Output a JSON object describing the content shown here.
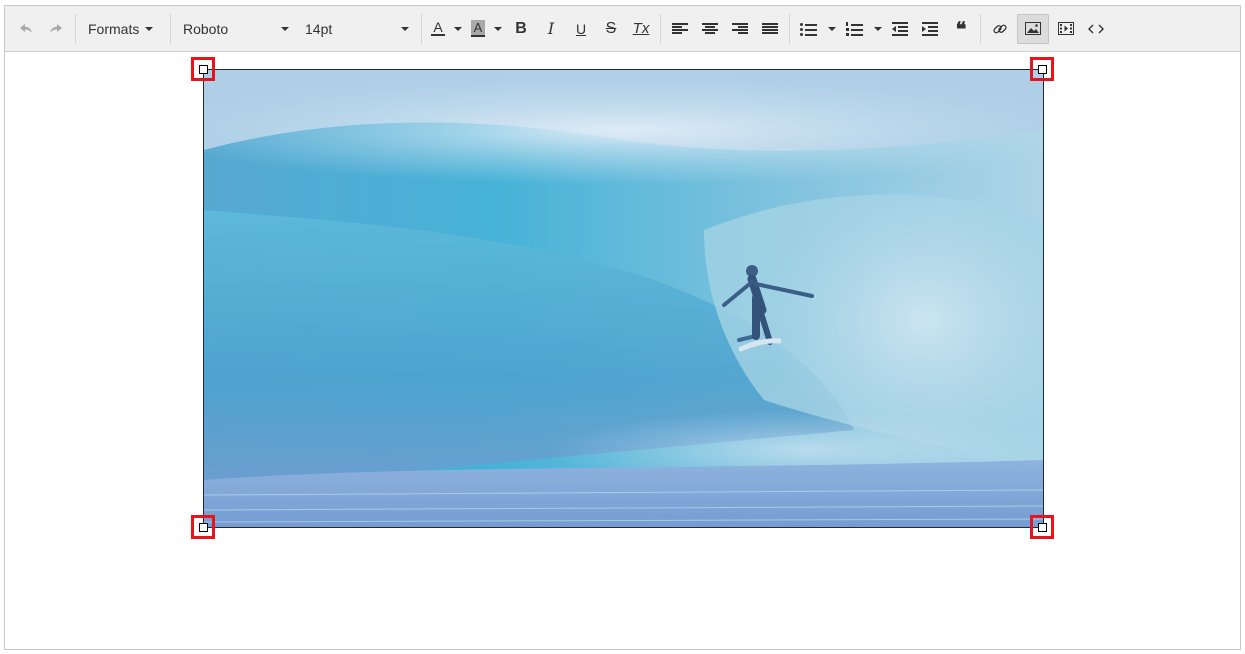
{
  "toolbar": {
    "undo_icon": "undo-icon",
    "redo_icon": "redo-icon",
    "formats_label": "Formats",
    "font_family": "Roboto",
    "font_size": "14pt",
    "text_color_glyph": "A",
    "bg_color_glyph": "A",
    "bold_glyph": "B",
    "italic_glyph": "I",
    "underline_glyph": "U",
    "strike_glyph": "S",
    "clear_format_glyph": "Tx",
    "blockquote_glyph": "❝"
  },
  "colors": {
    "toolbar_bg": "#f0f0f0",
    "handle_red": "#e8141c",
    "wave_light": "#8fd4e6",
    "wave_deep": "#2a9fc4"
  },
  "content": {
    "image_subject": "surfer-riding-wave",
    "image_selected": true
  }
}
